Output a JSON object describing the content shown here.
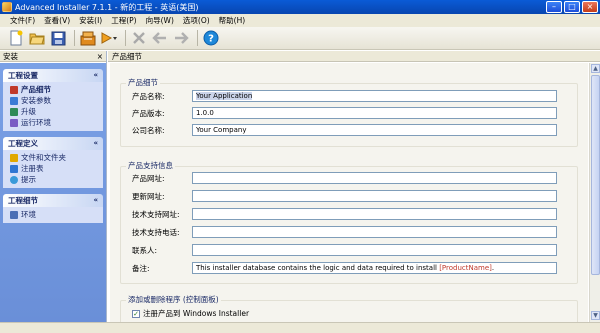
{
  "window": {
    "title": "Advanced Installer 7.1.1 - 新的工程 - 英语(美国)"
  },
  "menu": [
    "文件(F)",
    "查看(V)",
    "安装(I)",
    "工程(P)",
    "向导(W)",
    "选项(O)",
    "帮助(H)"
  ],
  "left_pane": {
    "header": "安装",
    "close": "×",
    "groups": [
      {
        "title": "工程设置",
        "chevron": "«",
        "items": [
          {
            "label": "产品细节",
            "icon_color": "#c0392b"
          },
          {
            "label": "安装参数",
            "icon_color": "#3a7bd5"
          },
          {
            "label": "升级",
            "icon_color": "#2e8b57"
          },
          {
            "label": "运行环境",
            "icon_color": "#7a5cc4"
          }
        ]
      },
      {
        "title": "工程定义",
        "chevron": "«",
        "items": [
          {
            "label": "文件和文件夹",
            "icon_color": "#e0a800"
          },
          {
            "label": "注册表",
            "icon_color": "#2f76d2"
          },
          {
            "label": "提示",
            "icon_color": "#3a9ad9"
          }
        ]
      },
      {
        "title": "工程细节",
        "chevron": "«",
        "items": [
          {
            "label": "环境",
            "icon_color": "#4b6fb5"
          }
        ]
      }
    ]
  },
  "main": {
    "header": "产品细节",
    "sections": [
      {
        "title": "产品细节",
        "fields": [
          {
            "label": "产品名称:",
            "value": "Your Application"
          },
          {
            "label": "产品版本:",
            "value": "1.0.0"
          },
          {
            "label": "公司名称:",
            "value": "Your Company"
          }
        ]
      },
      {
        "title": "产品支持信息",
        "fields": [
          {
            "label": "产品网址:",
            "value": ""
          },
          {
            "label": "更新网址:",
            "value": ""
          },
          {
            "label": "技术支持网址:",
            "value": ""
          },
          {
            "label": "技术支持电话:",
            "value": ""
          },
          {
            "label": "联系人:",
            "value": ""
          },
          {
            "label": "备注:",
            "value": "This installer database contains the logic and data required to install ",
            "token": "[ProductName]",
            "suffix": "."
          }
        ]
      },
      {
        "title": "添加或删除程序 (控制面板)",
        "checkboxes": [
          {
            "label": "注册产品到 Windows Installer",
            "checked": true
          },
          {
            "label": "",
            "checked": false
          }
        ]
      }
    ]
  },
  "colors": {
    "titlebar": "#0a5bd6",
    "sidebar": "#7aa1e6",
    "accent_token": "#c0392b"
  }
}
